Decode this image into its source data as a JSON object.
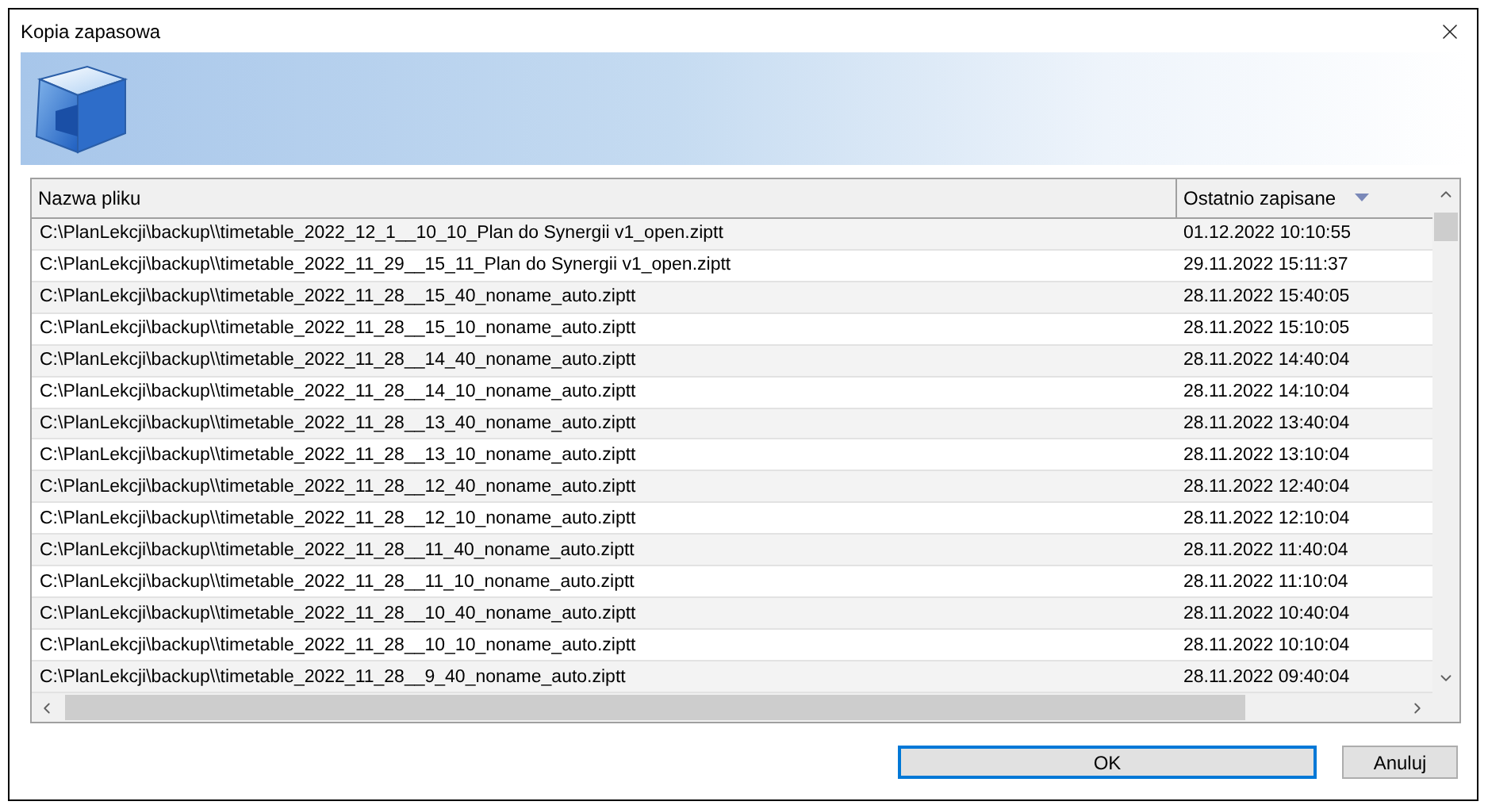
{
  "window": {
    "title": "Kopia zapasowa"
  },
  "table": {
    "columns": [
      {
        "label": "Nazwa pliku",
        "sorted": false
      },
      {
        "label": "Ostatnio zapisane",
        "sorted": true
      }
    ],
    "rows": [
      {
        "file": "C:\\PlanLekcji\\backup\\\\timetable_2022_12_1__10_10_Plan do Synergii v1_open.ziptt",
        "saved": "01.12.2022 10:10:55"
      },
      {
        "file": "C:\\PlanLekcji\\backup\\\\timetable_2022_11_29__15_11_Plan do Synergii v1_open.ziptt",
        "saved": "29.11.2022 15:11:37"
      },
      {
        "file": "C:\\PlanLekcji\\backup\\\\timetable_2022_11_28__15_40_noname_auto.ziptt",
        "saved": "28.11.2022 15:40:05"
      },
      {
        "file": "C:\\PlanLekcji\\backup\\\\timetable_2022_11_28__15_10_noname_auto.ziptt",
        "saved": "28.11.2022 15:10:05"
      },
      {
        "file": "C:\\PlanLekcji\\backup\\\\timetable_2022_11_28__14_40_noname_auto.ziptt",
        "saved": "28.11.2022 14:40:04"
      },
      {
        "file": "C:\\PlanLekcji\\backup\\\\timetable_2022_11_28__14_10_noname_auto.ziptt",
        "saved": "28.11.2022 14:10:04"
      },
      {
        "file": "C:\\PlanLekcji\\backup\\\\timetable_2022_11_28__13_40_noname_auto.ziptt",
        "saved": "28.11.2022 13:40:04"
      },
      {
        "file": "C:\\PlanLekcji\\backup\\\\timetable_2022_11_28__13_10_noname_auto.ziptt",
        "saved": "28.11.2022 13:10:04"
      },
      {
        "file": "C:\\PlanLekcji\\backup\\\\timetable_2022_11_28__12_40_noname_auto.ziptt",
        "saved": "28.11.2022 12:40:04"
      },
      {
        "file": "C:\\PlanLekcji\\backup\\\\timetable_2022_11_28__12_10_noname_auto.ziptt",
        "saved": "28.11.2022 12:10:04"
      },
      {
        "file": "C:\\PlanLekcji\\backup\\\\timetable_2022_11_28__11_40_noname_auto.ziptt",
        "saved": "28.11.2022 11:40:04"
      },
      {
        "file": "C:\\PlanLekcji\\backup\\\\timetable_2022_11_28__11_10_noname_auto.ziptt",
        "saved": "28.11.2022 11:10:04"
      },
      {
        "file": "C:\\PlanLekcji\\backup\\\\timetable_2022_11_28__10_40_noname_auto.ziptt",
        "saved": "28.11.2022 10:40:04"
      },
      {
        "file": "C:\\PlanLekcji\\backup\\\\timetable_2022_11_28__10_10_noname_auto.ziptt",
        "saved": "28.11.2022 10:10:04"
      },
      {
        "file": "C:\\PlanLekcji\\backup\\\\timetable_2022_11_28__9_40_noname_auto.ziptt",
        "saved": "28.11.2022 09:40:04"
      }
    ]
  },
  "buttons": [
    {
      "label": "OK",
      "default": true
    },
    {
      "label": "Anuluj",
      "default": false
    }
  ]
}
